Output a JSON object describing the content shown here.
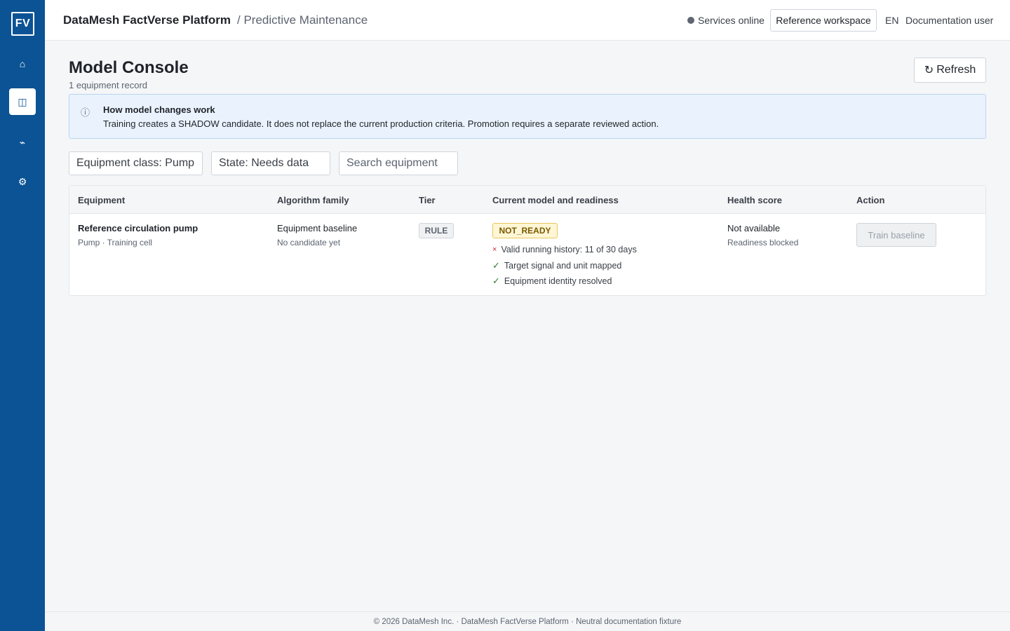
{
  "sidebar": {
    "logo": "FV",
    "items": [
      {
        "name": "home",
        "icon": "⌂"
      },
      {
        "name": "models",
        "icon": "◫"
      },
      {
        "name": "signals",
        "icon": "⌁"
      },
      {
        "name": "settings",
        "icon": "⚙"
      }
    ]
  },
  "header": {
    "brand": "DataMesh FactVerse Platform",
    "breadcrumb": "/ Predictive Maintenance",
    "status": "Services online",
    "workspace": "Reference workspace",
    "language": "EN",
    "user": "Documentation user"
  },
  "page": {
    "title": "Model Console",
    "subtitle": "1 equipment record",
    "refresh_label": "Refresh"
  },
  "info": {
    "icon": "ⓘ",
    "title": "How model changes work",
    "text": "Training creates a SHADOW candidate. It does not replace the current production criteria. Promotion requires a separate reviewed action."
  },
  "filters": {
    "equipment_class": "Equipment class: Pump",
    "state": "State: Needs data",
    "search_placeholder": "Search equipment"
  },
  "table": {
    "columns": [
      "Equipment",
      "Algorithm family",
      "Tier",
      "Current model and readiness",
      "Health score",
      "Action"
    ],
    "rows": [
      {
        "equipment_name": "Reference circulation pump",
        "equipment_meta": "Pump · Training cell",
        "algorithm": "Equipment baseline",
        "algorithm_note": "No candidate yet",
        "tier": "RULE",
        "state": "NOT_READY",
        "checks": [
          {
            "ok": false,
            "mark": "×",
            "text": "Valid running history: 11 of 30 days"
          },
          {
            "ok": true,
            "mark": "✓",
            "text": "Target signal and unit mapped"
          },
          {
            "ok": true,
            "mark": "✓",
            "text": "Equipment identity resolved"
          }
        ],
        "health": "Not available",
        "health_note": "Readiness blocked",
        "action": "Train baseline"
      }
    ]
  },
  "footer": "© 2026 DataMesh Inc. · DataMesh FactVerse Platform · Neutral documentation fixture"
}
